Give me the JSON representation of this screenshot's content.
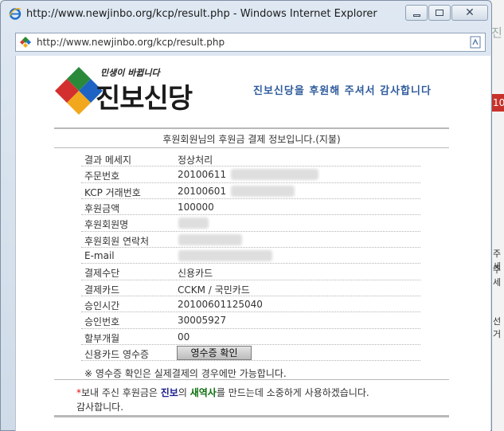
{
  "window": {
    "title": "http://www.newjinbo.org/kcp/result.php - Windows Internet Explorer",
    "address": "http://www.newjinbo.org/kcp/result.php"
  },
  "page": {
    "logo_slogan": "민생이 바뀝니다",
    "logo_name": "진보신당",
    "thanks": "진보신당을 후원해 주셔서 감사합니다",
    "info_title": "후원회원님의 후원금 결제 정보입니다.(지불)",
    "rows": [
      {
        "label": "결과 메세지",
        "value": "정상처리"
      },
      {
        "label": "주문번호",
        "value": "20100611"
      },
      {
        "label": "KCP 거래번호",
        "value": "20100601"
      },
      {
        "label": "후원금액",
        "value": "100000"
      },
      {
        "label": "후원회원명",
        "value": ""
      },
      {
        "label": "후원회원 연락처",
        "value": ""
      },
      {
        "label": "E-mail",
        "value": ""
      },
      {
        "label": "결제수단",
        "value": "신용카드"
      },
      {
        "label": "결제카드",
        "value": "CCKM / 국민카드"
      },
      {
        "label": "승인시간",
        "value": "20100601125040"
      },
      {
        "label": "승인번호",
        "value": "30005927"
      },
      {
        "label": "할부개월",
        "value": "00"
      },
      {
        "label": "신용카드 영수증",
        "value": ""
      }
    ],
    "receipt_button": "영수증 확인",
    "receipt_note": "※ 영수증 확인은 실제결제의 경우에만 가능합니다.",
    "msg_star": "*",
    "msg_part1": "보내 주신 후원금은 ",
    "msg_jinbo": "진보",
    "msg_part2": "의 ",
    "msg_saeyeoksa": "새역사",
    "msg_part3": "를 만드는데 소중하게 사용하겠습니다.",
    "msg_line2": "감사합니다."
  },
  "background_peek": {
    "red_tab": "10",
    "t1": "주세",
    "t2": "주세",
    "t3": "선거"
  },
  "colors": {
    "thanks_text": "#2f5c9c",
    "jinbo_text": "#1c1f8c",
    "saeyeoksa_text": "#0b6e0b",
    "star": "#d11111"
  }
}
